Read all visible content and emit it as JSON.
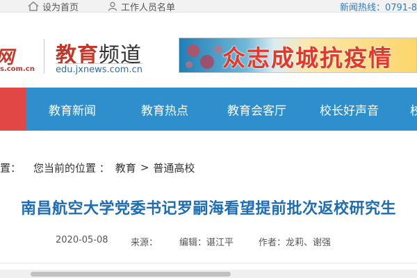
{
  "topbar": {
    "set_home": "设为首页",
    "staff_list": "工作人员名单",
    "hotline": "新闻热线：0791-8"
  },
  "header": {
    "logo_text": "网",
    "logo_url": "s.com.cn",
    "channel_bold": "教育",
    "channel_light": "频道",
    "channel_url": "edu.jxnews.com.cn",
    "banner_slogan": "众志成城抗疫情"
  },
  "nav": {
    "items": [
      "教育新闻",
      "教育热点",
      "教育会客厅",
      "校长好声音",
      "校"
    ]
  },
  "breadcrumb": {
    "prefix": "置：",
    "label": "您当前的位置 ：",
    "level1": "教育",
    "sep": ">",
    "level2": "普通高校"
  },
  "article": {
    "title": "南昌航空大学党委书记罗嗣海看望提前批次返校研究生",
    "date": "2020-05-08",
    "source": "来源：",
    "editor": "编辑：谌江平",
    "author": "作者：龙莉、谢强"
  },
  "colors": {
    "nav_blue": "#2f8fcd",
    "nav_red": "#e14744",
    "title_blue": "#1d6cb4",
    "brand_red": "#c0392b"
  }
}
